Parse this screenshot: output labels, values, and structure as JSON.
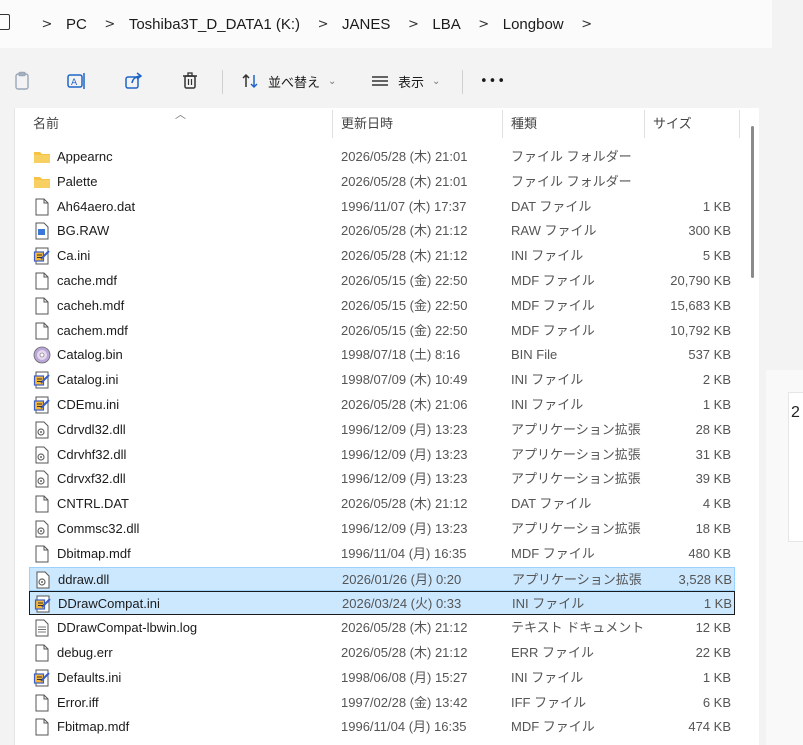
{
  "breadcrumb": [
    "PC",
    "Toshiba3T_D_DATA1 (K:)",
    "JANES",
    "LBA",
    "Longbow"
  ],
  "toolbar": {
    "sort_label": "並べ替え",
    "view_label": "表示",
    "more_label": "•••"
  },
  "columns": {
    "name": "名前",
    "date": "更新日時",
    "type": "種類",
    "size": "サイズ"
  },
  "files": [
    {
      "name": "Appearnc",
      "date": "2026/05/28 (木) 21:01",
      "type": "ファイル フォルダー",
      "size": "",
      "icon": "folder-icon"
    },
    {
      "name": "Palette",
      "date": "2026/05/28 (木) 21:01",
      "type": "ファイル フォルダー",
      "size": "",
      "icon": "folder-icon"
    },
    {
      "name": "Ah64aero.dat",
      "date": "1996/11/07 (木) 17:37",
      "type": "DAT ファイル",
      "size": "1 KB",
      "icon": "file-icon"
    },
    {
      "name": "BG.RAW",
      "date": "2026/05/28 (木) 21:12",
      "type": "RAW ファイル",
      "size": "300 KB",
      "icon": "image-file-icon"
    },
    {
      "name": "Ca.ini",
      "date": "2026/05/28 (木) 21:12",
      "type": "INI ファイル",
      "size": "5 KB",
      "icon": "ini-file-icon"
    },
    {
      "name": "cache.mdf",
      "date": "2026/05/15 (金) 22:50",
      "type": "MDF ファイル",
      "size": "20,790 KB",
      "icon": "file-icon"
    },
    {
      "name": "cacheh.mdf",
      "date": "2026/05/15 (金) 22:50",
      "type": "MDF ファイル",
      "size": "15,683 KB",
      "icon": "file-icon"
    },
    {
      "name": "cachem.mdf",
      "date": "2026/05/15 (金) 22:50",
      "type": "MDF ファイル",
      "size": "10,792 KB",
      "icon": "file-icon"
    },
    {
      "name": "Catalog.bin",
      "date": "1998/07/18 (土) 8:16",
      "type": "BIN File",
      "size": "537 KB",
      "icon": "disc-file-icon"
    },
    {
      "name": "Catalog.ini",
      "date": "1998/07/09 (木) 10:49",
      "type": "INI ファイル",
      "size": "2 KB",
      "icon": "ini-file-icon"
    },
    {
      "name": "CDEmu.ini",
      "date": "2026/05/28 (木) 21:06",
      "type": "INI ファイル",
      "size": "1 KB",
      "icon": "ini-file-icon"
    },
    {
      "name": "Cdrvdl32.dll",
      "date": "1996/12/09 (月) 13:23",
      "type": "アプリケーション拡張",
      "size": "28 KB",
      "icon": "dll-file-icon"
    },
    {
      "name": "Cdrvhf32.dll",
      "date": "1996/12/09 (月) 13:23",
      "type": "アプリケーション拡張",
      "size": "31 KB",
      "icon": "dll-file-icon"
    },
    {
      "name": "Cdrvxf32.dll",
      "date": "1996/12/09 (月) 13:23",
      "type": "アプリケーション拡張",
      "size": "39 KB",
      "icon": "dll-file-icon"
    },
    {
      "name": "CNTRL.DAT",
      "date": "2026/05/28 (木) 21:12",
      "type": "DAT ファイル",
      "size": "4 KB",
      "icon": "file-icon"
    },
    {
      "name": "Commsc32.dll",
      "date": "1996/12/09 (月) 13:23",
      "type": "アプリケーション拡張",
      "size": "18 KB",
      "icon": "dll-file-icon"
    },
    {
      "name": "Dbitmap.mdf",
      "date": "1996/11/04 (月) 16:35",
      "type": "MDF ファイル",
      "size": "480 KB",
      "icon": "file-icon"
    },
    {
      "name": "ddraw.dll",
      "date": "2026/01/26 (月) 0:20",
      "type": "アプリケーション拡張",
      "size": "3,528 KB",
      "icon": "dll-file-icon",
      "selected": true
    },
    {
      "name": "DDrawCompat.ini",
      "date": "2026/03/24 (火) 0:33",
      "type": "INI ファイル",
      "size": "1 KB",
      "icon": "ini-file-icon",
      "selected": true,
      "focused": true
    },
    {
      "name": "DDrawCompat-lbwin.log",
      "date": "2026/05/28 (木) 21:12",
      "type": "テキスト ドキュメント",
      "size": "12 KB",
      "icon": "text-file-icon"
    },
    {
      "name": "debug.err",
      "date": "2026/05/28 (木) 21:12",
      "type": "ERR ファイル",
      "size": "22 KB",
      "icon": "file-icon"
    },
    {
      "name": "Defaults.ini",
      "date": "1998/06/08 (月) 15:27",
      "type": "INI ファイル",
      "size": "1 KB",
      "icon": "ini-file-icon"
    },
    {
      "name": "Error.iff",
      "date": "1997/02/28 (金) 13:42",
      "type": "IFF ファイル",
      "size": "6 KB",
      "icon": "file-icon"
    },
    {
      "name": "Fbitmap.mdf",
      "date": "1996/11/04 (月) 16:35",
      "type": "MDF ファイル",
      "size": "474 KB",
      "icon": "file-icon"
    }
  ],
  "side_fragment_text": "2",
  "colors": {
    "selection": "#cce8ff",
    "selection_border": "#99d1ff",
    "folder": "#f6c342",
    "ini_badge": "#3a5fc6"
  }
}
